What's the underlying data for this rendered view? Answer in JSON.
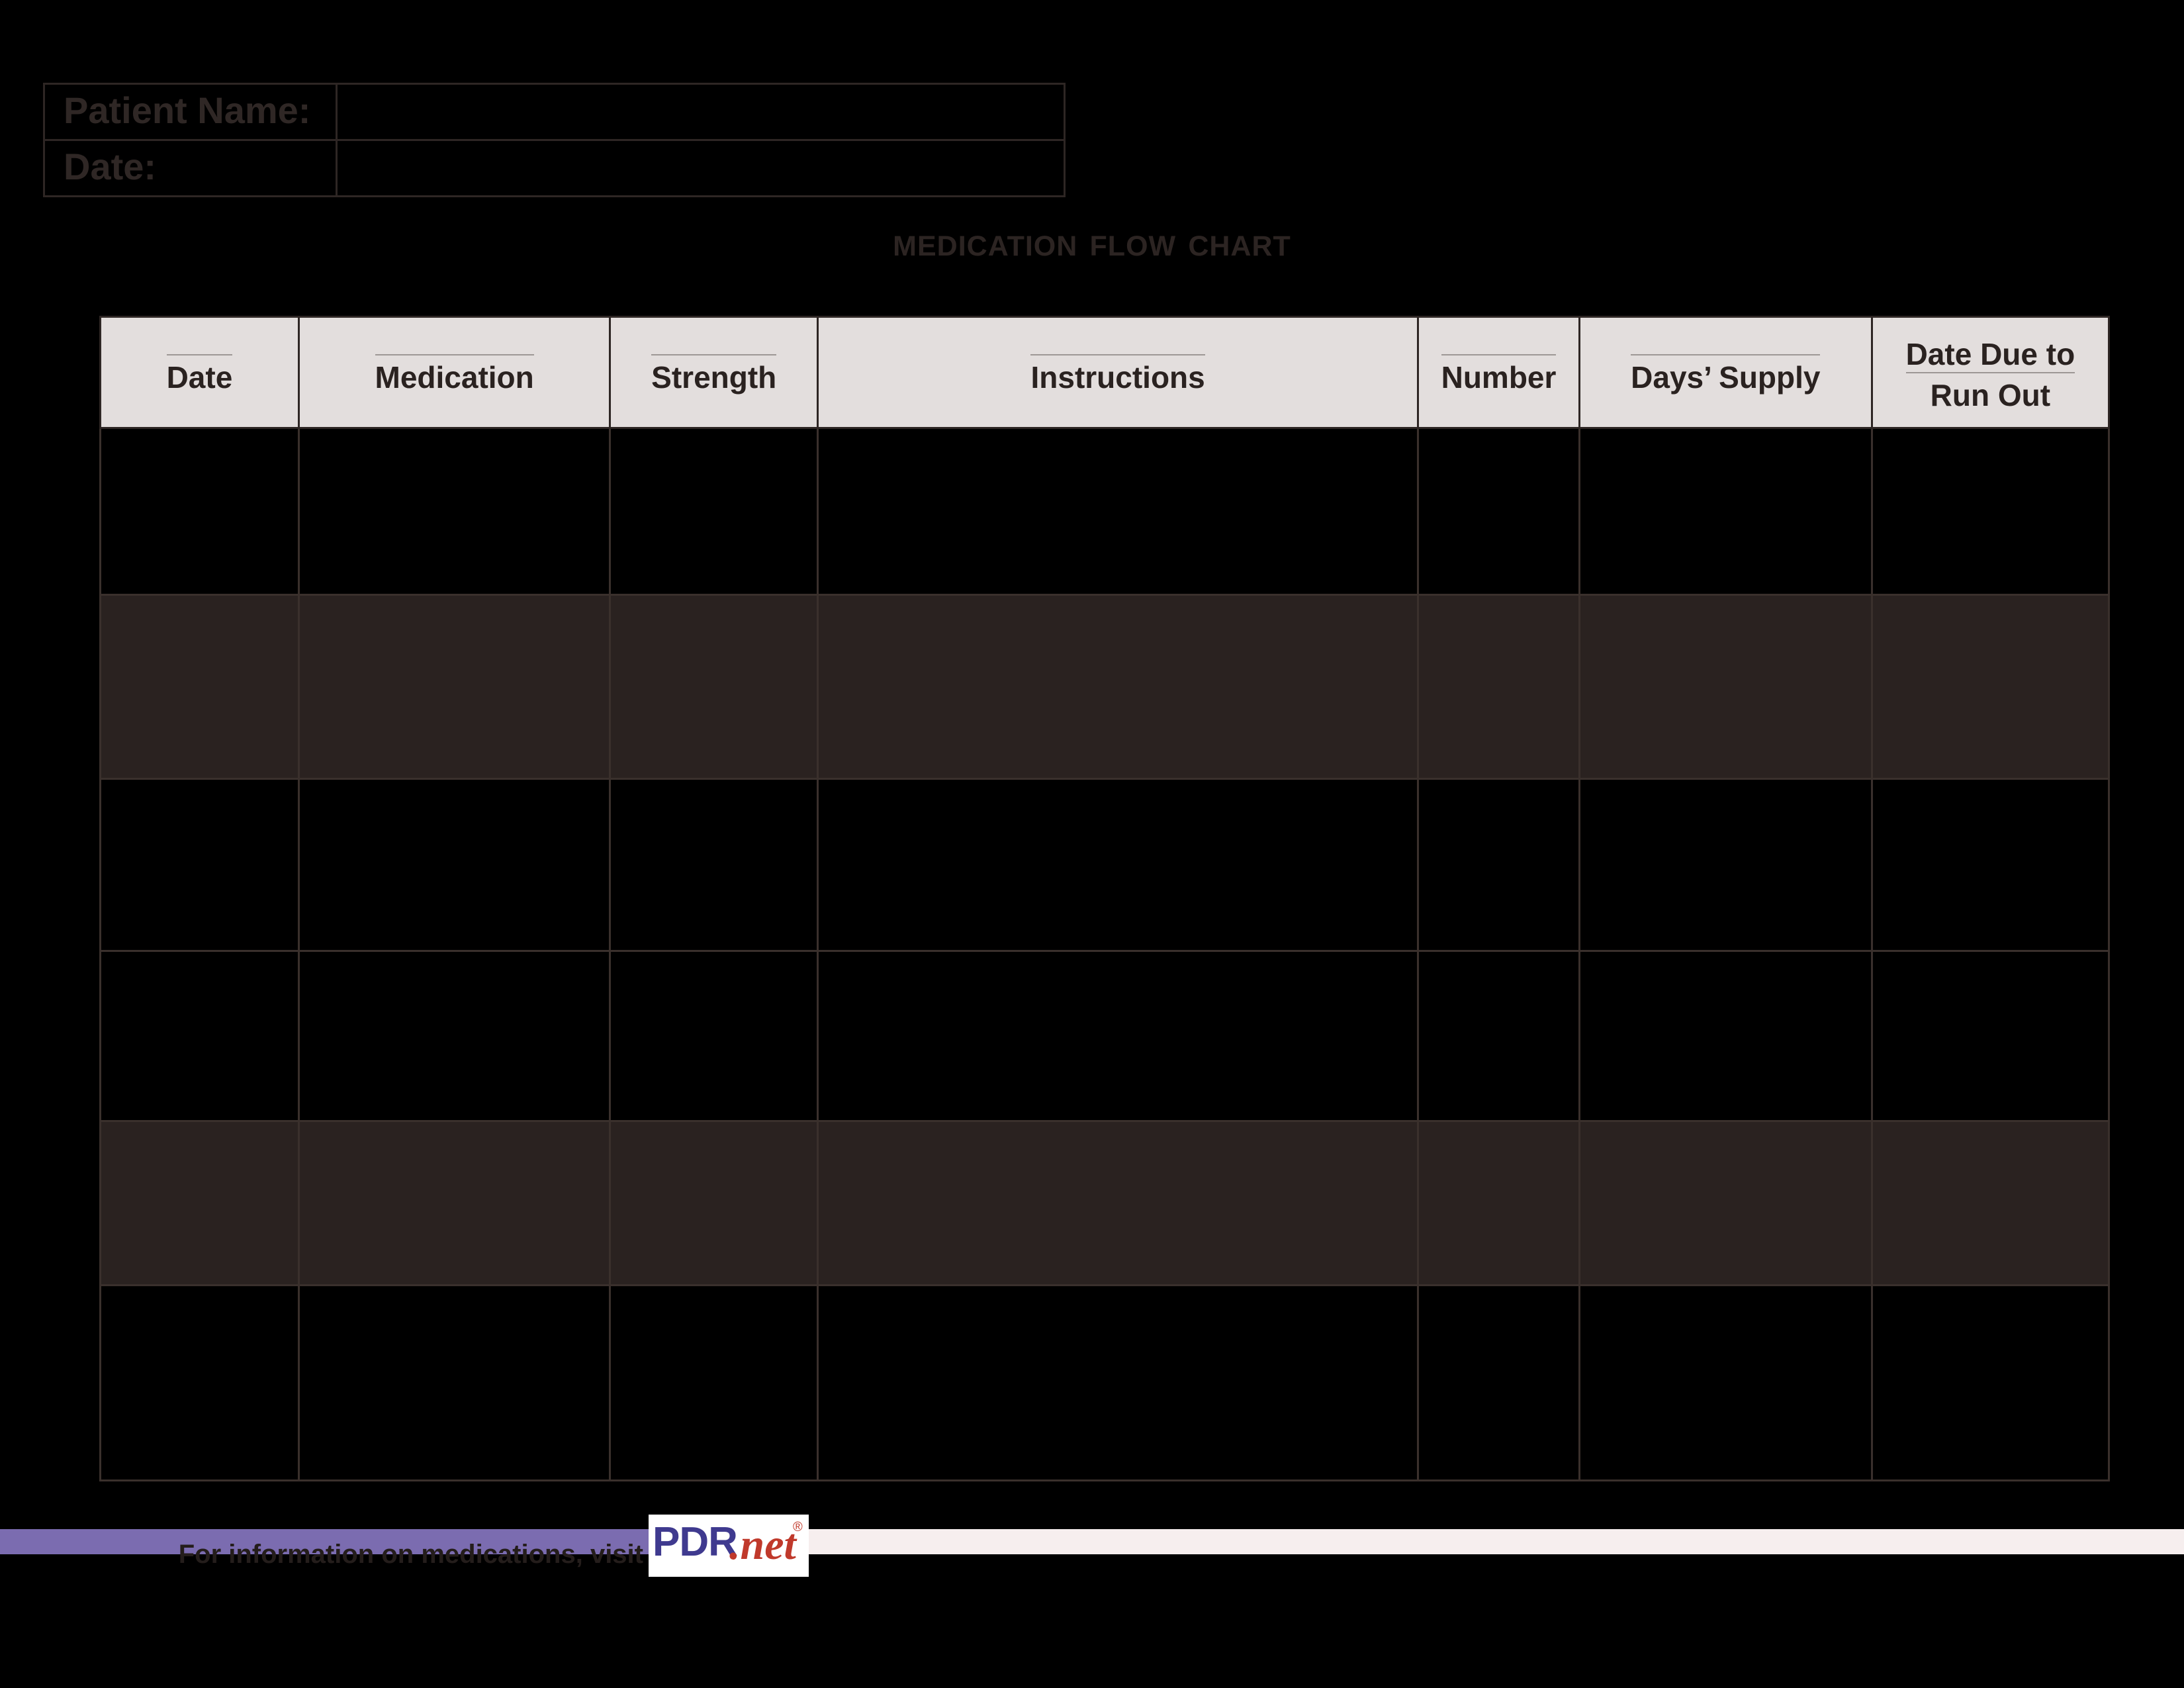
{
  "patient_info": {
    "rows": [
      {
        "label": "Patient Name:",
        "value": ""
      },
      {
        "label": "Date:",
        "value": ""
      }
    ]
  },
  "title": "Medication Flow Chart",
  "table": {
    "columns": [
      {
        "label": "Date",
        "lines": [
          "Date"
        ]
      },
      {
        "label": "Medication",
        "lines": [
          "Medication"
        ]
      },
      {
        "label": "Strength",
        "lines": [
          "Strength"
        ]
      },
      {
        "label": "Instructions",
        "lines": [
          "Instructions"
        ]
      },
      {
        "label": "Number",
        "lines": [
          "Number"
        ]
      },
      {
        "label": "Days’ Supply",
        "lines": [
          "Days’ Supply"
        ]
      },
      {
        "label": "Date Due to Run Out",
        "lines": [
          "Date Due to",
          "Run Out"
        ]
      }
    ],
    "rows": [
      {
        "shaded": false,
        "cells": [
          "",
          "",
          "",
          "",
          "",
          "",
          ""
        ]
      },
      {
        "shaded": true,
        "cells": [
          "",
          "",
          "",
          "",
          "",
          "",
          ""
        ]
      },
      {
        "shaded": false,
        "cells": [
          "",
          "",
          "",
          "",
          "",
          "",
          ""
        ]
      },
      {
        "shaded": false,
        "cells": [
          "",
          "",
          "",
          "",
          "",
          "",
          ""
        ]
      },
      {
        "shaded": true,
        "cells": [
          "",
          "",
          "",
          "",
          "",
          "",
          ""
        ]
      },
      {
        "shaded": false,
        "cells": [
          "",
          "",
          "",
          "",
          "",
          "",
          ""
        ]
      }
    ]
  },
  "footer": {
    "text": "For information on medications, visit",
    "logo": {
      "primary": "PDR",
      "secondary": ".net",
      "registered": "®"
    }
  },
  "colors": {
    "page_background": "#000000",
    "header_cell_background": "#e3dedd",
    "row_shaded_background": "#2a2220",
    "border": "#2e2624",
    "text_dark": "#2b2422",
    "footer_bar_purple": "#7b6cb0",
    "footer_strip": "#f6eeee",
    "logo_blue": "#3f3a8f",
    "logo_red": "#c0392b"
  }
}
